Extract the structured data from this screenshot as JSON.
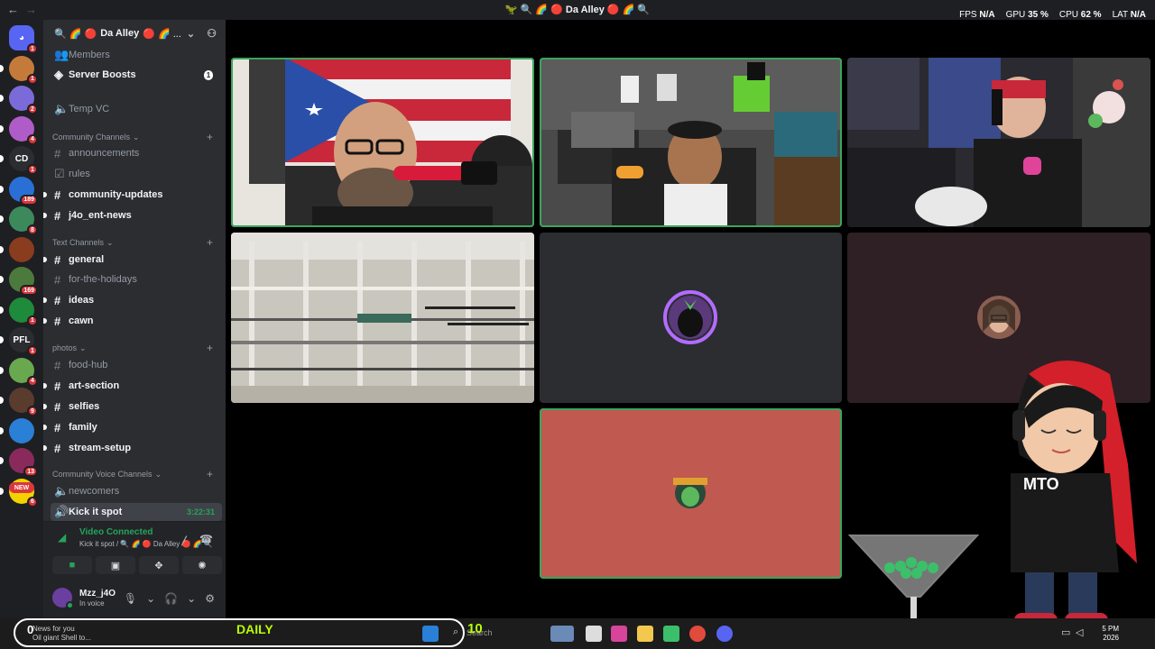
{
  "window": {
    "title": "Da Alley",
    "title_emojis": "🦖 🔍 🌈 🔴 Da Alley 🔴 🌈 🔍"
  },
  "overlay": {
    "fps_label": "FPS",
    "fps_value": "N/A",
    "gpu_label": "GPU",
    "gpu_value": "35 %",
    "cpu_label": "CPU",
    "cpu_value": "62 %",
    "lat_label": "LAT",
    "lat_value": "N/A"
  },
  "rail": {
    "servers": [
      {
        "initials": "",
        "color": "#5865f2",
        "badge": "1"
      },
      {
        "initials": "",
        "color": "#c47b3a",
        "badge": "1"
      },
      {
        "initials": "",
        "color": "#7a6bd8",
        "badge": "2"
      },
      {
        "initials": "",
        "color": "#b05cc8",
        "badge": "4"
      },
      {
        "initials": "CD",
        "color": "#2b2d31",
        "badge": "1"
      },
      {
        "initials": "",
        "color": "#2a6fd6",
        "badge": "189"
      },
      {
        "initials": "",
        "color": "#3c8a5c",
        "badge": "8"
      },
      {
        "initials": "",
        "color": "#8a3c1e",
        "badge": ""
      },
      {
        "initials": "",
        "color": "#4c7a3c",
        "badge": "169"
      },
      {
        "initials": "",
        "color": "#1e8a3c",
        "badge": "1"
      },
      {
        "initials": "PFL",
        "color": "#2b2d31",
        "badge": "1"
      },
      {
        "initials": "",
        "color": "#6aa84f",
        "badge": "4"
      },
      {
        "initials": "",
        "color": "#5a3c2e",
        "badge": "9"
      },
      {
        "initials": "",
        "color": "#2a7fd6",
        "badge": ""
      },
      {
        "initials": "",
        "color": "#8a2a5c",
        "badge": "13"
      },
      {
        "initials": "",
        "color": "#f2d200",
        "badge": "6"
      }
    ],
    "new_label": "NEW"
  },
  "server": {
    "name": "Da Alley",
    "name_prefix": "🔍 🌈 🔴",
    "name_suffix": "🔴 🌈 ..."
  },
  "channels": {
    "members": "Members",
    "server_boosts": "Server Boosts",
    "server_boosts_count": "1",
    "temp_vc": "Temp VC",
    "categories": {
      "community": "Community Channels",
      "text": "Text Channels",
      "photos": "photos",
      "community_voice": "Community Voice Channels"
    },
    "community": [
      "announcements",
      "rules",
      "community-updates",
      "j4o_ent-news"
    ],
    "text": [
      "general",
      "for-the-holidays",
      "ideas",
      "cawn"
    ],
    "photos": [
      "food-hub",
      "art-section",
      "selfies",
      "family",
      "stream-setup"
    ],
    "voice": [
      "newcomers",
      "Kick it spot"
    ],
    "active_timer": "3:22:31"
  },
  "voice_panel": {
    "status": "Video Connected",
    "location": "Kick it spot / 🔍 🌈 🔴 Da Alley 🔴 🌈 🔍"
  },
  "user": {
    "name": "Mzz_j4O",
    "status": "In voice"
  },
  "overlay_art": {
    "mto_label": "MTO"
  },
  "taskbar": {
    "news_line1": "News for you",
    "news_line2": "Oil giant Shell to...",
    "daily": "DAILY",
    "streak_zero": "0",
    "streak_ten": "10",
    "search": "Search",
    "time": "5 PM",
    "date": "2026"
  }
}
